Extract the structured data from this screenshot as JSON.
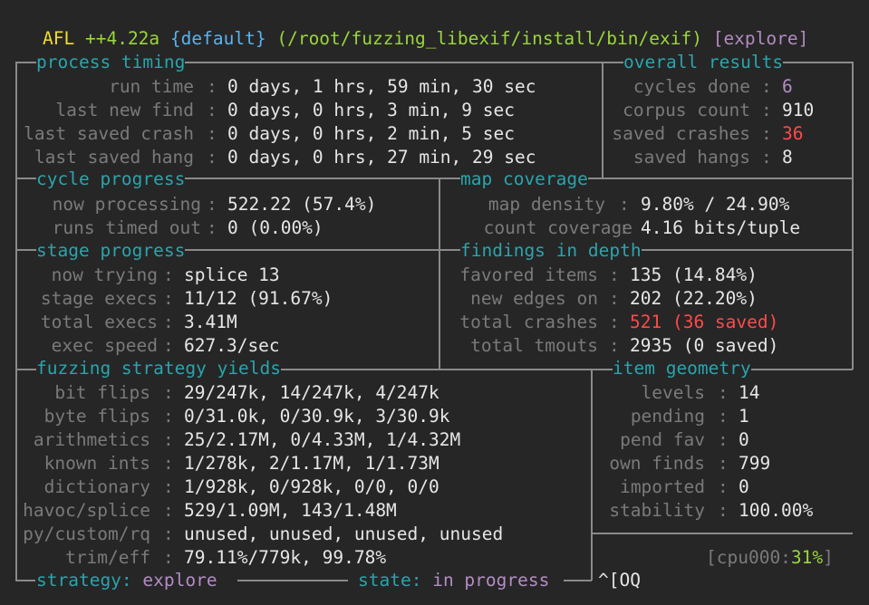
{
  "banner": {
    "app": "AFL",
    "version": "++4.22a",
    "instance": "{default}",
    "target": "(/root/fuzzing_libexif/install/bin/exif)",
    "mode": "[explore]"
  },
  "process_timing": {
    "title": "process timing",
    "rows": [
      {
        "label": "run time",
        "value": "0 days, 1 hrs, 59 min, 30 sec"
      },
      {
        "label": "last new find",
        "value": "0 days, 0 hrs, 3 min, 9 sec"
      },
      {
        "label": "last saved crash",
        "value": "0 days, 0 hrs, 2 min, 5 sec"
      },
      {
        "label": "last saved hang",
        "value": "0 days, 0 hrs, 27 min, 29 sec"
      }
    ]
  },
  "overall_results": {
    "title": "overall results",
    "rows": [
      {
        "label": "cycles done",
        "value": "6"
      },
      {
        "label": "corpus count",
        "value": "910"
      },
      {
        "label": "saved crashes",
        "value": "36"
      },
      {
        "label": "saved hangs",
        "value": "8"
      }
    ]
  },
  "cycle_progress": {
    "title": "cycle progress",
    "rows": [
      {
        "label": "now processing",
        "value": "522.22 (57.4%)"
      },
      {
        "label": "runs timed out",
        "value": "0 (0.00%)"
      }
    ]
  },
  "map_coverage": {
    "title": "map coverage",
    "rows": [
      {
        "label": "map density",
        "value": "9.80% / 24.90%"
      },
      {
        "label": "count coverage",
        "value": "4.16 bits/tuple"
      }
    ]
  },
  "stage_progress": {
    "title": "stage progress",
    "rows": [
      {
        "label": "now trying",
        "value": "splice 13"
      },
      {
        "label": "stage execs",
        "value": "11/12 (91.67%)"
      },
      {
        "label": "total execs",
        "value": "3.41M"
      },
      {
        "label": "exec speed",
        "value": "627.3/sec"
      }
    ]
  },
  "findings": {
    "title": "findings in depth",
    "rows": [
      {
        "label": "favored items",
        "value": "135 (14.84%)"
      },
      {
        "label": "new edges on",
        "value": "202 (22.20%)"
      },
      {
        "label": "total crashes",
        "value": "521 (36 saved)"
      },
      {
        "label": "total tmouts",
        "value": "2935 (0 saved)"
      }
    ]
  },
  "strategy_yields": {
    "title": "fuzzing strategy yields",
    "rows": [
      {
        "label": "bit flips",
        "value": "29/247k, 14/247k, 4/247k"
      },
      {
        "label": "byte flips",
        "value": "0/31.0k, 0/30.9k, 3/30.9k"
      },
      {
        "label": "arithmetics",
        "value": "25/2.17M, 0/4.33M, 1/4.32M"
      },
      {
        "label": "known ints",
        "value": "1/278k, 2/1.17M, 1/1.73M"
      },
      {
        "label": "dictionary",
        "value": "1/928k, 0/928k, 0/0, 0/0"
      },
      {
        "label": "havoc/splice",
        "value": "529/1.09M, 143/1.48M"
      },
      {
        "label": "py/custom/rq",
        "value": "unused, unused, unused, unused"
      },
      {
        "label": "trim/eff",
        "value": "79.11%/779k, 99.78%"
      }
    ]
  },
  "item_geometry": {
    "title": "item geometry",
    "rows": [
      {
        "label": "levels",
        "value": "14"
      },
      {
        "label": "pending",
        "value": "1"
      },
      {
        "label": "pend fav",
        "value": "0"
      },
      {
        "label": "own finds",
        "value": "799"
      },
      {
        "label": "imported",
        "value": "0"
      },
      {
        "label": "stability",
        "value": "100.00%"
      }
    ]
  },
  "cpu": {
    "prefix": "[cpu000:",
    "value": "31%",
    "suffix": "]"
  },
  "footer": {
    "strategy_label": "strategy:",
    "strategy_value": "explore",
    "state_label": "state:",
    "state_value": "in progress",
    "trailer": "^[OQ"
  },
  "separator": ":",
  "colors": {
    "background": "#262626",
    "title": "#2aa4ad",
    "label": "#7a7a7a",
    "value": "#e6e6e6",
    "crash": "#ff4a4a",
    "accent": "#b28ac2",
    "ok": "#9ad63c"
  }
}
